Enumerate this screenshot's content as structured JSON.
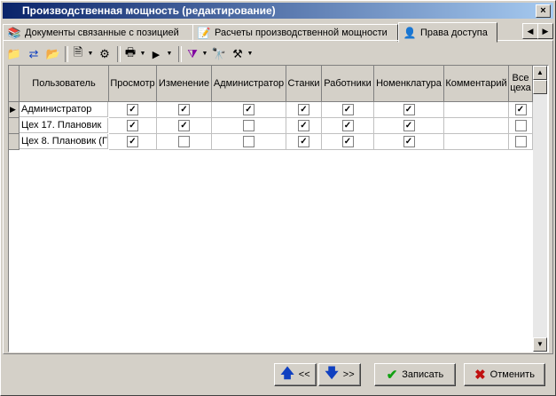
{
  "window": {
    "title": "Производственная мощность (редактирование)",
    "close_glyph": "×"
  },
  "tabs": [
    {
      "label": "Документы связанные с позицией"
    },
    {
      "label": "Расчеты производственной мощности"
    },
    {
      "label": "Права доступа"
    }
  ],
  "grid": {
    "columns": [
      "Пользователь",
      "Просмотр",
      "Изменение",
      "Администратор",
      "Станки",
      "Работники",
      "Номенклатура",
      "Комментарий",
      "Все цеха"
    ],
    "rows": [
      {
        "user": "Администратор",
        "checks": [
          true,
          true,
          true,
          true,
          true,
          true,
          null,
          true
        ]
      },
      {
        "user": "Цех 17. Плановик",
        "checks": [
          true,
          true,
          false,
          true,
          true,
          true,
          null,
          false
        ]
      },
      {
        "user": "Цех 8. Плановик (Г",
        "checks": [
          true,
          false,
          false,
          true,
          true,
          true,
          null,
          false
        ]
      }
    ]
  },
  "footer": {
    "prev_label": "<<",
    "next_label": ">>",
    "save_label": "Записать",
    "cancel_label": "Отменить"
  },
  "colors": {
    "title_start": "#0a246a",
    "title_end": "#a6caf0",
    "arrow_blue": "#1040c0",
    "save_green": "#10a010",
    "cancel_red": "#c01010"
  }
}
